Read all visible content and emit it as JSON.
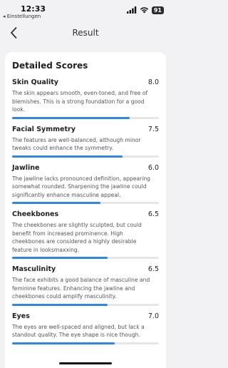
{
  "status_bar": {
    "time": "12:33",
    "back_app": "◂ Einstellungen",
    "battery": "91"
  },
  "nav": {
    "title": "Result"
  },
  "card": {
    "title": "Detailed Scores",
    "scores": [
      {
        "name": "Skin Quality",
        "value": "8.0",
        "level": 0.8,
        "description": "The skin appears smooth, even-toned, and free of blemishes.  This is a strong foundation for a good look."
      },
      {
        "name": "Facial Symmetry",
        "value": "7.5",
        "level": 0.75,
        "description": "The features are well-balanced, although minor tweaks could enhance the symmetry."
      },
      {
        "name": "Jawline",
        "value": "6.0",
        "level": 0.6,
        "description": "The jawline lacks pronounced definition, appearing somewhat rounded. Sharpening the jawline could significantly enhance masculine appeal."
      },
      {
        "name": "Cheekbones",
        "value": "6.5",
        "level": 0.65,
        "description": "The cheekbones are slightly sculpted, but could benefit from increased prominence.  High cheekbones are considered a highly desirable feature in looksmaxxing."
      },
      {
        "name": "Masculinity",
        "value": "6.5",
        "level": 0.65,
        "description": "The face exhibits a good balance of masculine and feminine features. Enhancing the jawline and cheekbones could amplify masculinity."
      },
      {
        "name": "Eyes",
        "value": "7.0",
        "level": 0.7,
        "description": "The eyes are well-spaced and aligned, but lack a standout quality. The eye shape is nice though."
      }
    ]
  },
  "colors": {
    "accent": "#2e86e6",
    "background": "#f2f2f4",
    "card": "#ffffff"
  }
}
